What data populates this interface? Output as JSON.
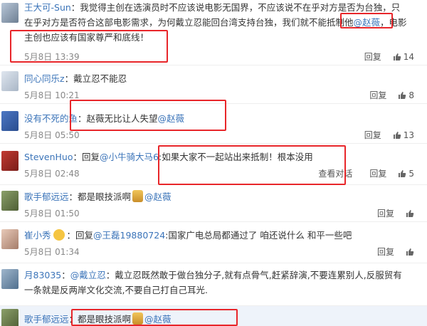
{
  "comments": [
    {
      "user": "王大可-Sun",
      "text_a": "：我觉得主创在选演员时不应该说电影无国界，不应该说不在乎对方是否为台独，只在乎对方是否符合这部电影需求，为何戴立忍能回台湾支持台独，我们就不能抵制他",
      "mention": "@赵薇",
      "text_b": "，电影主创也应该有国家尊严和底线！",
      "time": "5月8日 13:39",
      "reply": "回复",
      "likes": "14"
    },
    {
      "user": "同心同乐z",
      "text_a": "：戴立忍不能忍",
      "time": "5月8日 10:21",
      "reply": "回复",
      "likes": "8"
    },
    {
      "user": "没有不死的鱼",
      "text_a": "：赵薇无比让人失望",
      "mention": "@赵薇",
      "time": "5月8日 05:50",
      "reply": "回复",
      "likes": "13"
    },
    {
      "user": "StevenHuo",
      "text_a": "：回复",
      "mention": "@小牛骑大马6",
      "text_b": ":如果大家不一起站出来抵制！根本没用",
      "time": "5月8日 02:48",
      "view_conversation": "查看对话",
      "reply": "回复",
      "likes": "5"
    },
    {
      "user": "歌手郁远远",
      "text_a": "：都是眼技派啊",
      "mention": "@赵薇",
      "time": "5月8日 01:50",
      "reply": "回复"
    },
    {
      "user": "崔小秀",
      "text_a": "：回复",
      "mention": "@王磊19880724",
      "text_b": ":国家广电总局都通过了 咱还说什么 和平一些吧",
      "time": "5月8日 01:34",
      "reply": "回复"
    },
    {
      "user": "月83035",
      "text_a": "：",
      "mention": "@戴立忍",
      "text_b": "：戴立忍既然敢于做台独分子,就有点骨气,赶紧辞演,不要连累别人,反服贸有一条就是反两岸文化交流,不要自己打自己耳光."
    },
    {
      "user": "歌手郁远远",
      "text_a": "：都是眼技派啊",
      "mention": "@赵薇"
    }
  ],
  "colors": {
    "link": "#3b74b9",
    "highlight": "#e8262a",
    "time": "#888888"
  },
  "icons": {
    "like": "thumbs-up-icon",
    "vip": "vip-badge-icon"
  }
}
